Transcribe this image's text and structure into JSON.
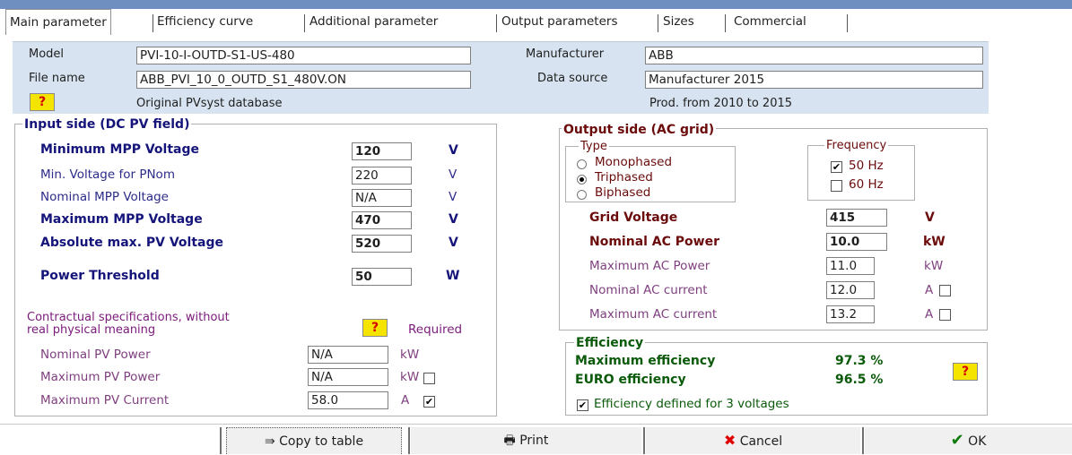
{
  "tabs": [
    "Main parameter",
    "Efficiency curve",
    "Additional parameter",
    "Output parameters",
    "Sizes",
    "Commercial"
  ],
  "header": {
    "model_label": "Model",
    "model_value": "PVI-10-I-OUTD-S1-US-480",
    "filename_label": "File name",
    "filename_value": "ABB_PVI_10_0_OUTD_S1_480V.ON",
    "help": "?",
    "db_text": "Original PVsyst database",
    "manufacturer_label": "Manufacturer",
    "manufacturer_value": "ABB",
    "datasource_label": "Data source",
    "datasource_value": "Manufacturer 2015",
    "prod_text": "Prod. from 2010 to 2015"
  },
  "input_side": {
    "title": "Input side (DC PV field)",
    "rows": [
      {
        "label": "Minimum MPP Voltage",
        "value": "120",
        "unit": "V"
      },
      {
        "label": "Min. Voltage for PNom",
        "value": "220",
        "unit": "V"
      },
      {
        "label": "Nominal  MPP Voltage",
        "value": "N/A",
        "unit": "V"
      },
      {
        "label": "Maximum MPP Voltage",
        "value": "470",
        "unit": "V"
      },
      {
        "label": "Absolute max. PV Voltage",
        "value": "520",
        "unit": "V"
      },
      {
        "label": "Power Threshold",
        "value": "50",
        "unit": "W"
      }
    ],
    "contract_text_1": "Contractual specifications,  without",
    "contract_text_2": "real physical meaning",
    "help": "?",
    "required": "Required",
    "contract_rows": [
      {
        "label": "Nominal PV Power",
        "value": "N/A",
        "unit": "kW"
      },
      {
        "label": "Maximum PV Power",
        "value": "N/A",
        "unit": "kW"
      },
      {
        "label": "Maximum PV Current",
        "value": "58.0",
        "unit": "A"
      }
    ]
  },
  "output_side": {
    "title": "Output side (AC grid)",
    "type_title": "Type",
    "types": [
      "Monophased",
      "Triphased",
      "Biphased"
    ],
    "type_selected": "Triphased",
    "freq_title": "Frequency",
    "freqs": [
      "50 Hz",
      "60 Hz"
    ],
    "freq_checked": "50 Hz",
    "rows": [
      {
        "label": "Grid Voltage",
        "value": "415",
        "unit": "V"
      },
      {
        "label": "Nominal AC Power",
        "value": "10.0",
        "unit": "kW"
      },
      {
        "label": "Maximum AC Power",
        "value": "11.0",
        "unit": "kW"
      },
      {
        "label": "Nominal AC current",
        "value": "12.0",
        "unit": "A"
      },
      {
        "label": "Maximum AC current",
        "value": "13.2",
        "unit": "A"
      }
    ]
  },
  "efficiency": {
    "title": "Efficiency",
    "max_label": "Maximum efficiency",
    "max_value": "97.3 %",
    "euro_label": "EURO efficiency",
    "euro_value": "96.5 %",
    "help": "?",
    "defined_label": "Efficiency defined for 3 voltages"
  },
  "buttons": {
    "copy": "Copy to table",
    "print": "Print",
    "cancel": "Cancel",
    "ok": "OK"
  },
  "colors": {
    "header_bg": "#d7e3f0",
    "help_bg": "#f5e400",
    "accent_blue": "#14147a",
    "dark_red": "#6b0b0b",
    "green": "#0a5a0a"
  }
}
